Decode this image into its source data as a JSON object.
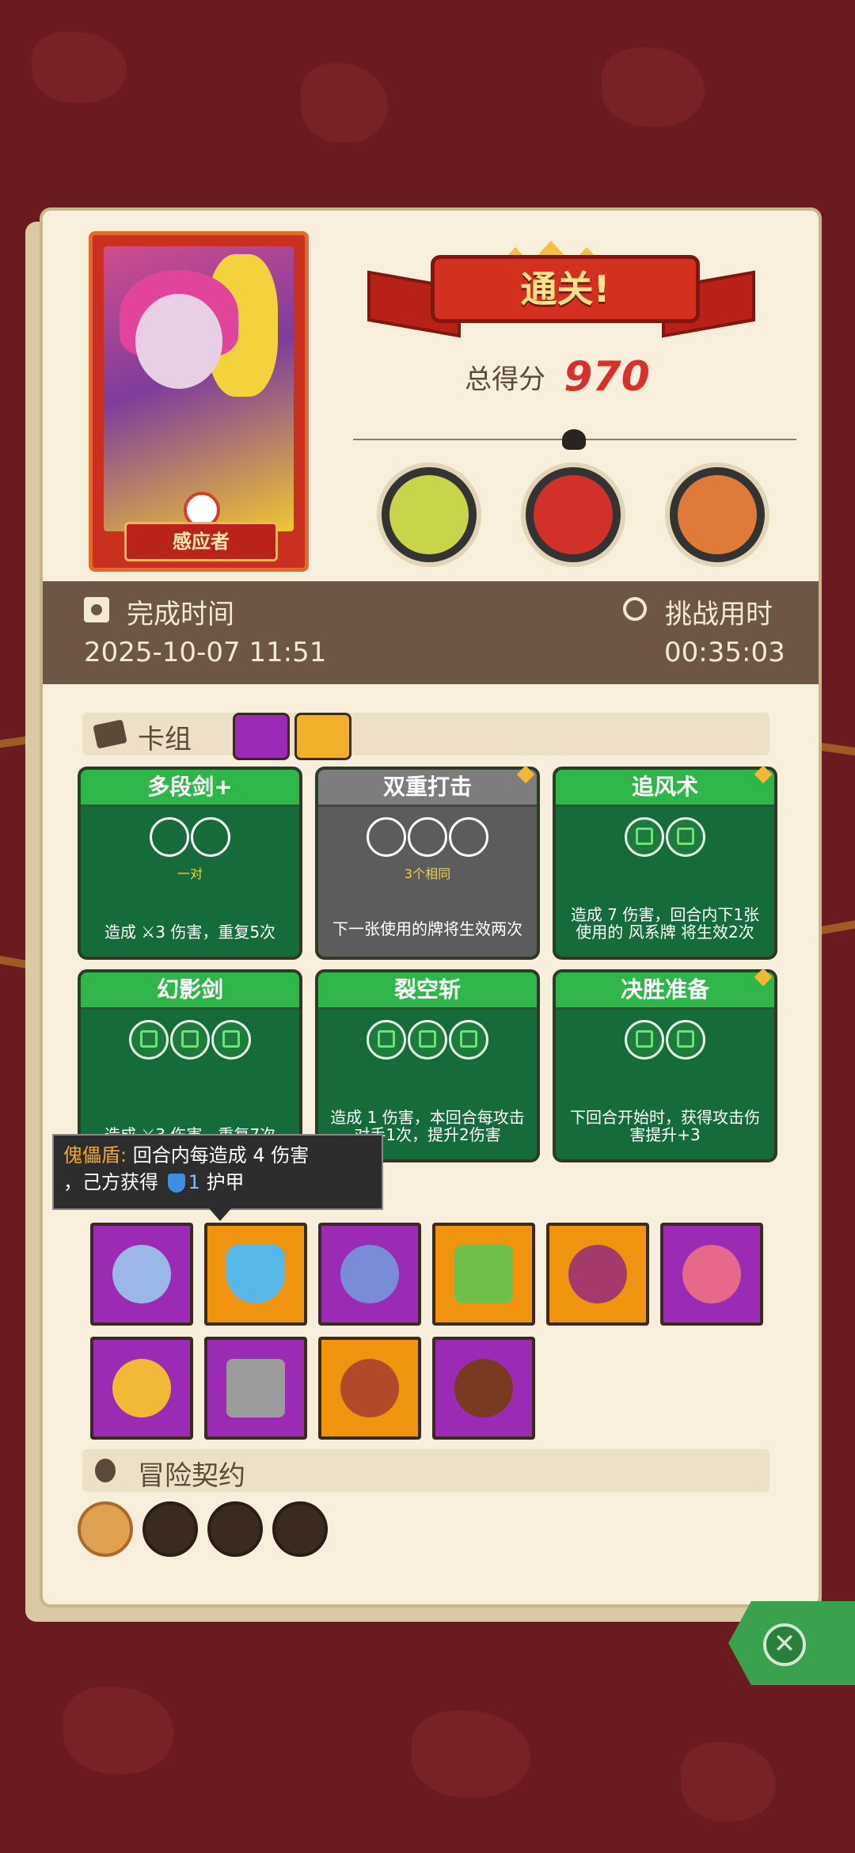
{
  "header": {
    "title": "通关!",
    "score_label": "总得分",
    "score_value": "970"
  },
  "character": {
    "name": "感应者"
  },
  "bosses": [
    "boss-lizard-skeleton",
    "boss-red-knight",
    "boss-fish-general"
  ],
  "times": {
    "finish_label": "完成时间",
    "finish_value": "2025-10-07 11:51",
    "challenge_label": "挑战用时",
    "challenge_value": "00:35:03"
  },
  "deck": {
    "title": "卡组",
    "cards": [
      {
        "name": "多段剑+",
        "sub": "一对",
        "desc": "造成 ⚔3 伤害，重复5次",
        "style": "green",
        "slots": 2
      },
      {
        "name": "双重打击",
        "sub": "3个相同",
        "desc": "下一张使用的牌将生效两次",
        "style": "grey",
        "slots": 3
      },
      {
        "name": "追风术",
        "sub": "",
        "desc": "造成 7 伤害，回合内下1张使用的 风系牌 将生效2次",
        "style": "green",
        "slots": 2
      },
      {
        "name": "幻影剑",
        "sub": "",
        "desc": "造成 ⚔3 伤害，重复7次",
        "style": "green",
        "slots": 3
      },
      {
        "name": "裂空斩",
        "sub": "",
        "desc": "造成 1 伤害，本回合每攻击对手1次，提升2伤害",
        "style": "green",
        "slots": 3
      },
      {
        "name": "决胜准备",
        "sub": "",
        "desc": "下回合开始时，获得攻击伤害提升+3",
        "style": "green",
        "slots": 2
      }
    ]
  },
  "tooltip": {
    "name": "傀儡盾:",
    "line1": "回合内每造成 4 伤害",
    "line2_a": "，己方获得",
    "value": "1",
    "line2_b": "护甲"
  },
  "relics": [
    {
      "icon": "sapphire-ring-icon",
      "color": "purple"
    },
    {
      "icon": "puppet-shield-icon",
      "color": "orange"
    },
    {
      "icon": "crescent-hook-icon",
      "color": "purple"
    },
    {
      "icon": "green-moss-tablet-icon",
      "color": "orange"
    },
    {
      "icon": "thorn-heart-icon",
      "color": "orange"
    },
    {
      "icon": "spotted-egg-icon",
      "color": "purple"
    },
    {
      "icon": "gold-gem-ring-icon",
      "color": "purple"
    },
    {
      "icon": "stone-cube-icon",
      "color": "purple"
    },
    {
      "icon": "lava-plate-icon",
      "color": "orange"
    },
    {
      "icon": "wooden-button-icon",
      "color": "purple"
    }
  ],
  "contracts": {
    "title": "冒险契约",
    "items": [
      "scroll-icon",
      "golden-talisman-icon",
      "jade-ring-icon",
      "green-potion-icon"
    ]
  },
  "colors": {
    "background": "#6b1a1f",
    "panel": "#f7efdc",
    "score": "#d8302a",
    "card_green": "#166b3a",
    "relic_purple": "#9b2bb5",
    "relic_orange": "#f0940f"
  }
}
